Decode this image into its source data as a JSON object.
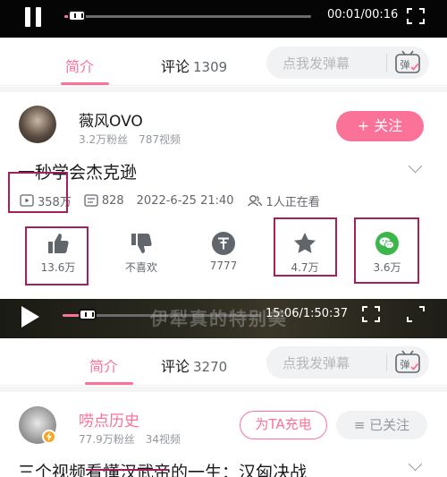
{
  "player1": {
    "time": "00:01/00:16",
    "progress": 0.04
  },
  "tabs1": {
    "intro": "简介",
    "comments": "评论",
    "comment_count": "1309",
    "danmaku_placeholder": "点我发弹幕",
    "danmaku_icon_label": "弹"
  },
  "video1": {
    "author": "薇风OVO",
    "fans": "3.2万粉丝",
    "videos": "787视频",
    "follow": "+ 关注",
    "title": "一秒学会杰克逊",
    "plays": "358万",
    "danmaku_count": "828",
    "date": "2022-6-25 21:40",
    "watching": "1人正在看",
    "actions": [
      {
        "icon": "thumbs-up-icon",
        "label": "13.6万"
      },
      {
        "icon": "thumbs-down-icon",
        "label": "不喜欢"
      },
      {
        "icon": "coin-icon",
        "label": "7777"
      },
      {
        "icon": "star-icon",
        "label": "4.7万"
      },
      {
        "icon": "wechat-icon",
        "label": "3.6万"
      }
    ]
  },
  "player2": {
    "time": "15:06/1:50:37",
    "progress": 0.14,
    "overlay_text": "伊犁真的特别美"
  },
  "tabs2": {
    "intro": "简介",
    "comments": "评论",
    "comment_count": "3270",
    "danmaku_placeholder": "点我发弹幕",
    "danmaku_icon_label": "弹"
  },
  "video2": {
    "author": "唠点历史",
    "fans": "77.9万粉丝",
    "videos": "34视频",
    "charge": "为TA充电",
    "followed": "≡ 已关注",
    "title": "三个视频看懂汉武帝的一生：汉匈决战"
  },
  "colors": {
    "accent": "#fb7299",
    "highlight_box": "#a3205f"
  }
}
